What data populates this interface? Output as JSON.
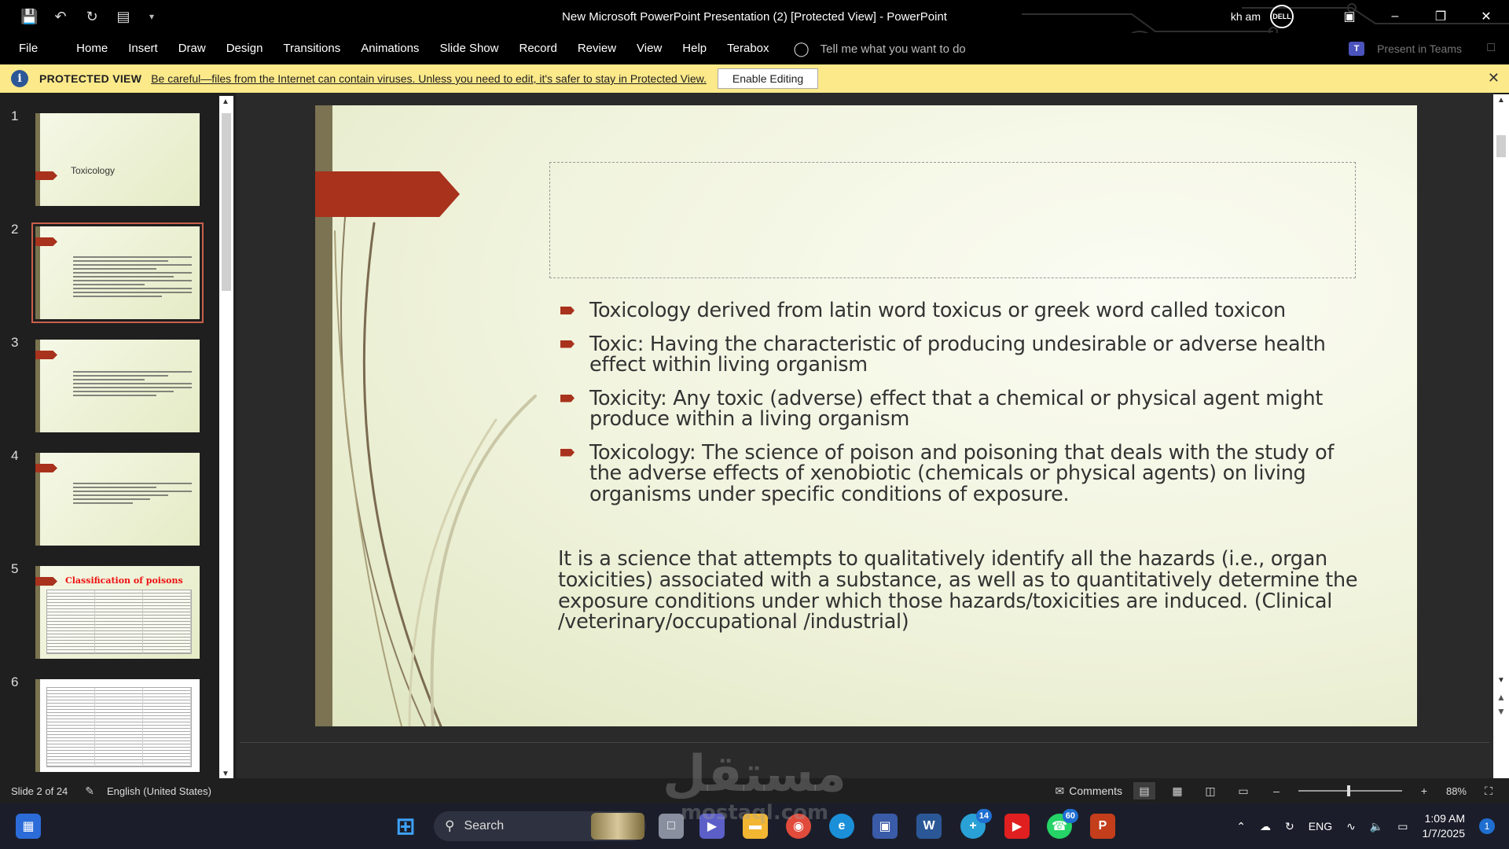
{
  "window": {
    "title": "New Microsoft PowerPoint Presentation (2) [Protected View]  -  PowerPoint",
    "user": "kh am",
    "logo": "DELL"
  },
  "qat": {
    "icons": [
      "save-icon",
      "undo-icon",
      "redo-icon",
      "start-from-beginning-icon",
      "customize-icon"
    ]
  },
  "menu": {
    "items": [
      "File",
      "Home",
      "Insert",
      "Draw",
      "Design",
      "Transitions",
      "Animations",
      "Slide Show",
      "Record",
      "Review",
      "View",
      "Help",
      "Terabox"
    ],
    "tell_me": "Tell me what you want to do",
    "present_in_teams": "Present in Teams"
  },
  "protected_view": {
    "label": "PROTECTED VIEW",
    "message": "Be careful—files from the Internet can contain viruses. Unless you need to edit, it's safer to stay in Protected View.",
    "button": "Enable Editing"
  },
  "thumbnails": [
    {
      "num": "1",
      "title": "Toxicology"
    },
    {
      "num": "2"
    },
    {
      "num": "3"
    },
    {
      "num": "4"
    },
    {
      "num": "5",
      "heading": "Classification of poisons"
    },
    {
      "num": "6"
    }
  ],
  "slide": {
    "bullets": [
      "Toxicology derived from latin word toxicus or  greek word called toxicon",
      "Toxic:  Having the characteristic of producing undesirable or adverse health effect within living organism",
      "Toxicity:  Any toxic (adverse) effect that a chemical or physical agent might produce within a living organism",
      "Toxicology:  The science of poison and poisoning that deals with the study of the adverse effects of xenobiotic (chemicals or physical agents) on living organisms under specific conditions of exposure."
    ],
    "paragraph": "It is a science that attempts to qualitatively identify all the hazards (i.e., organ toxicities) associated with a substance, as well as to quantitatively determine the exposure conditions under which those hazards/toxicities are induced. (Clinical /veterinary/occupational /industrial)",
    "accent_color": "#a8321c"
  },
  "status": {
    "slide_count": "Slide 2 of 24",
    "language": "English (United States)",
    "comments": "Comments",
    "zoom": "88%"
  },
  "taskbar": {
    "search": "Search",
    "teams_badge": "14",
    "whatsapp_badge": "60",
    "language": "ENG",
    "time": "1:09 AM",
    "date": "1/7/2025",
    "notif": "1"
  },
  "watermark": {
    "text": "مستقل",
    "sub": "mostaql.com"
  }
}
